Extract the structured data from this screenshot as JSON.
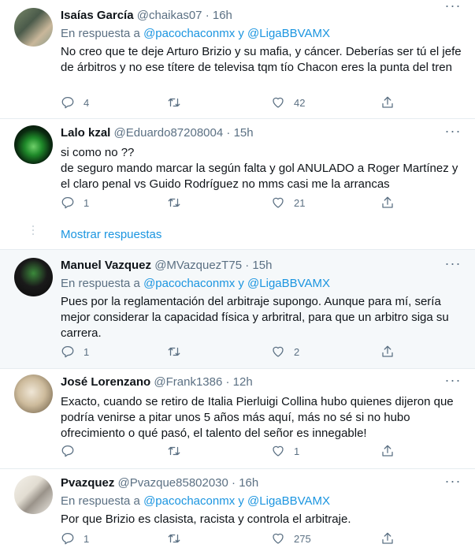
{
  "tweets": [
    {
      "name": "Isaías García",
      "handle": "@chaikas07",
      "time": "16h",
      "reply_prefix": "En respuesta a",
      "reply_user1": "@pacochaconmx",
      "reply_and": "y",
      "reply_user2": "@LigaBBVAMX",
      "text": "No creo que te deje Arturo Brizio y su mafia, y cáncer. Deberías ser tú el jefe de árbitros y no ese títere de televisa tqm tío Chacon eres la punta del tren",
      "replies": "4",
      "retweets": "",
      "likes": "42"
    },
    {
      "name": "Lalo kzal",
      "handle": "@Eduardo87208004",
      "time": "15h",
      "text_lines": [
        "si como no ??",
        "de seguro mando marcar la según falta y gol ANULADO a Roger Martínez y el claro penal vs Guido Rodríguez no mms casi me la arrancas"
      ],
      "replies": "1",
      "retweets": "",
      "likes": "21"
    },
    {
      "name": "Manuel Vazquez",
      "handle": "@MVazquezT75",
      "time": "15h",
      "reply_prefix": "En respuesta a",
      "reply_user1": "@pacochaconmx",
      "reply_and": "y",
      "reply_user2": "@LigaBBVAMX",
      "text": "Pues por la reglamentación del arbitraje supongo. Aunque para mí, sería mejor considerar la capacidad física y arbritral, para que un arbitro siga su carrera.",
      "replies": "1",
      "retweets": "",
      "likes": "2"
    },
    {
      "name": "José Lorenzano",
      "handle": "@Frank1386",
      "time": "12h",
      "text": "Exacto, cuando se retiro de Italia Pierluigi Collina hubo quienes dijeron que podría venirse a pitar unos 5 años más aquí, más no sé si no hubo ofrecimiento o qué pasó, el talento del señor es innegable!",
      "replies": "",
      "retweets": "",
      "likes": "1"
    },
    {
      "name": "Pvazquez",
      "handle": "@Pvazque85802030",
      "time": "16h",
      "reply_prefix": "En respuesta a",
      "reply_user1": "@pacochaconmx",
      "reply_and": "y",
      "reply_user2": "@LigaBBVAMX",
      "text": "Por que Brizio es clasista, racista y controla el arbitraje.",
      "replies": "1",
      "retweets": "",
      "likes": "275"
    }
  ],
  "show_replies": "Mostrar respuestas",
  "colors": {
    "link": "#1b95e0",
    "muted": "#5b7083",
    "text": "#0f1419",
    "separator": "#e6ecf0"
  },
  "icons": [
    "reply-icon",
    "retweet-icon",
    "like-icon",
    "share-icon",
    "more-icon"
  ]
}
